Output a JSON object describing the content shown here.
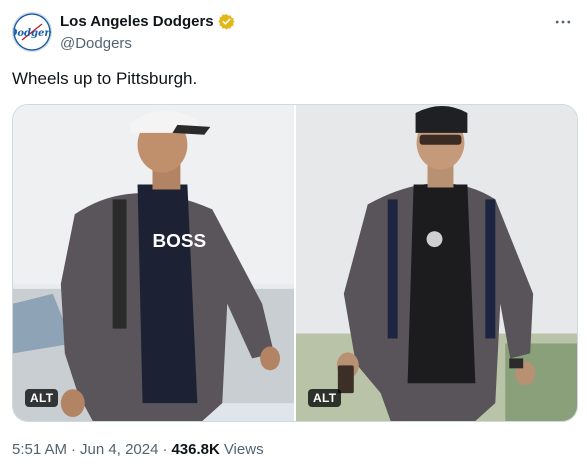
{
  "author": {
    "display_name": "Los Angeles Dodgers",
    "handle": "@Dodgers",
    "avatar_text": "Dodgers",
    "verified": true,
    "verified_color": "#e2b719"
  },
  "post": {
    "text": "Wheels up to Pittsburgh."
  },
  "media": [
    {
      "alt_label": "ALT",
      "shirt_text": "BOSS"
    },
    {
      "alt_label": "ALT"
    }
  ],
  "meta": {
    "time": "5:51 AM",
    "sep1": "·",
    "date": "Jun 4, 2024",
    "sep2": "·",
    "views": "436.8K",
    "views_label": "Views"
  },
  "colors": {
    "text": "#0f1419",
    "secondary": "#536471",
    "border": "#cfd9de",
    "brand_blue": "#1b5fa8"
  }
}
